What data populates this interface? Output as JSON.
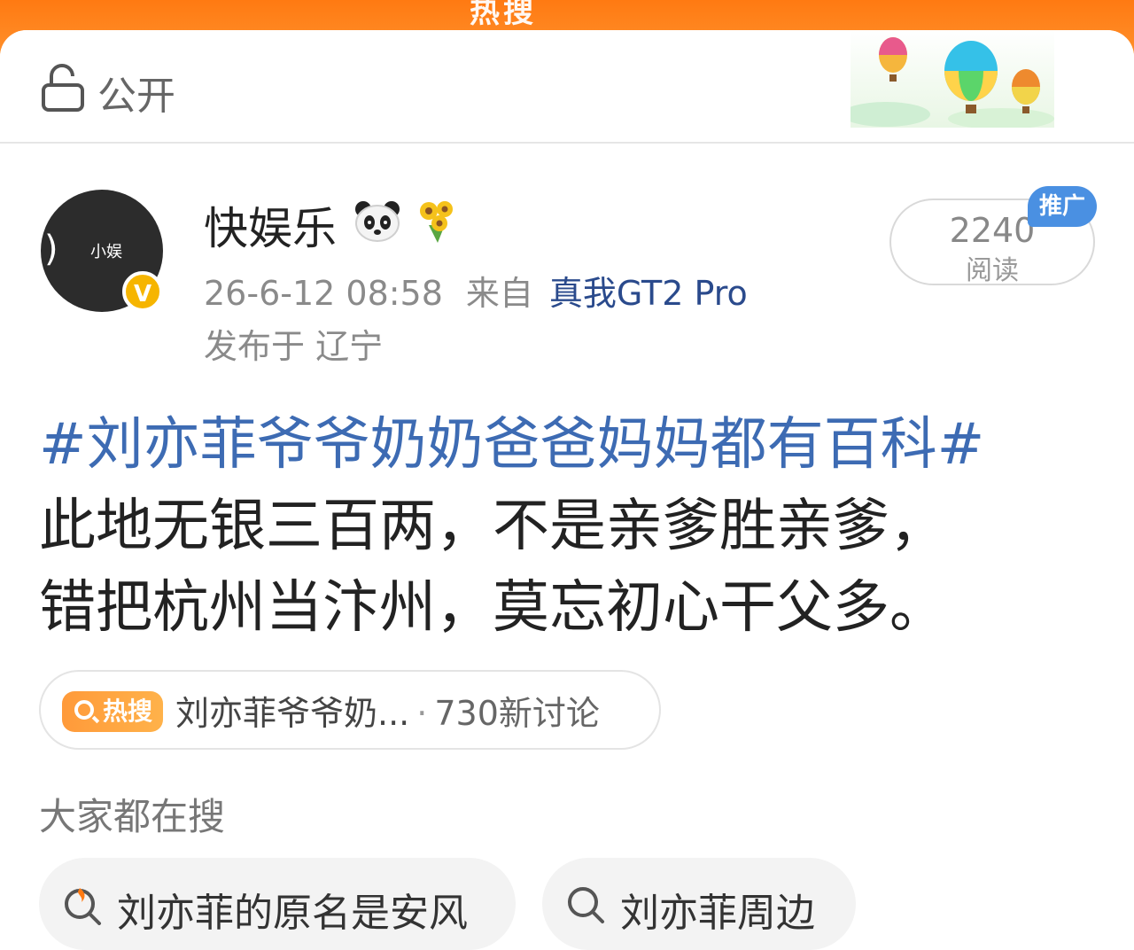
{
  "top_banner": {
    "text": "热搜"
  },
  "visibility": {
    "label": "公开",
    "icon": "lock-icon"
  },
  "author": {
    "name": "快娱乐",
    "avatar_text": "小娱",
    "verified_mark": "V",
    "timestamp": "26-6-12 08:58",
    "from_label": "来自",
    "device": "真我GT2 Pro",
    "location": "发布于 辽宁",
    "emoji_icons": [
      "panda-icon",
      "sunflower-icon"
    ]
  },
  "reads": {
    "count": "2240",
    "label": "阅读",
    "promo_badge": "推广"
  },
  "post": {
    "hashtag": "#刘亦菲爷爷奶奶爸爸妈妈都有百科#",
    "line1": "此地无银三百两，不是亲爹胜亲爹，",
    "line2": "错把杭州当汴州，莫忘初心干父多。"
  },
  "hot_search": {
    "tag": "热搜",
    "topic": "刘亦菲爷爷奶...",
    "separator": "·",
    "count": "730新讨论"
  },
  "related": {
    "title": "大家都在搜",
    "items": [
      {
        "label": "刘亦菲的原名是安风",
        "icon": "hot-search-icon"
      },
      {
        "label": "刘亦菲周边",
        "icon": "search-icon"
      }
    ]
  },
  "colors": {
    "accent": "#ff8a1f",
    "hashtag": "#3d6bb3",
    "device_link": "#2a4a8c",
    "promo": "#4a90e2",
    "verified": "#f6b500"
  }
}
